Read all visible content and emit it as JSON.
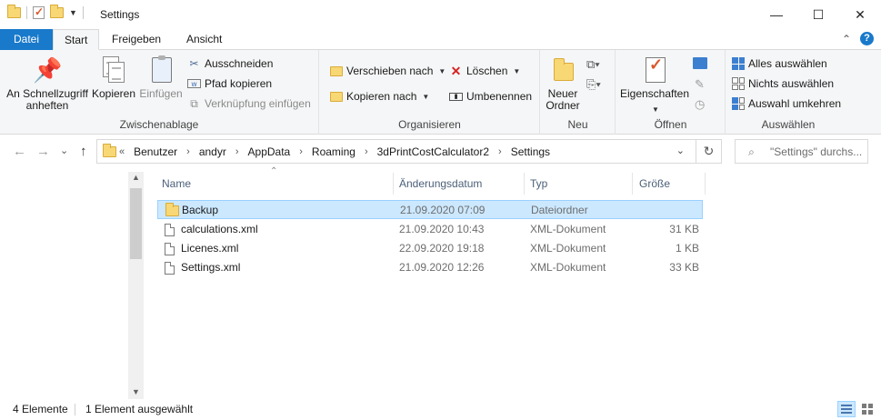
{
  "window": {
    "title": "Settings",
    "minimize_glyph": "—",
    "maximize_glyph": "☐",
    "close_glyph": "✕"
  },
  "tabs": {
    "file": "Datei",
    "start": "Start",
    "share": "Freigeben",
    "view": "Ansicht"
  },
  "ribbon": {
    "clipboard": {
      "label": "Zwischenablage",
      "pin_quick_access": "An Schnellzugriff anheften",
      "copy": "Kopieren",
      "paste": "Einfügen",
      "cut": "Ausschneiden",
      "copy_path": "Pfad kopieren",
      "paste_shortcut": "Verknüpfung einfügen"
    },
    "organize": {
      "label": "Organisieren",
      "move_to": "Verschieben nach",
      "copy_to": "Kopieren nach",
      "delete": "Löschen",
      "rename": "Umbenennen"
    },
    "new": {
      "label": "Neu",
      "new_folder": "Neuer Ordner"
    },
    "open": {
      "label": "Öffnen",
      "properties": "Eigenschaften"
    },
    "select": {
      "label": "Auswählen",
      "select_all": "Alles auswählen",
      "select_none": "Nichts auswählen",
      "invert_selection": "Auswahl umkehren"
    }
  },
  "navigation": {
    "back_glyph": "←",
    "forward_glyph": "→",
    "recent_glyph": "⌄",
    "up_glyph": "↑",
    "overflow_glyph": "«",
    "breadcrumb": [
      "Benutzer",
      "andyr",
      "AppData",
      "Roaming",
      "3dPrintCostCalculator2",
      "Settings"
    ],
    "crumb_separator": "›",
    "dropdown_glyph": "⌄",
    "refresh_glyph": "↻",
    "search_placeholder": "\"Settings\" durchs..."
  },
  "columns": {
    "name": "Name",
    "date": "Änderungsdatum",
    "type": "Typ",
    "size": "Größe"
  },
  "files": [
    {
      "name": "Backup",
      "date": "21.09.2020 07:09",
      "type": "Dateiordner",
      "size": "",
      "kind": "folder",
      "selected": true
    },
    {
      "name": "calculations.xml",
      "date": "21.09.2020 10:43",
      "type": "XML-Dokument",
      "size": "31 KB",
      "kind": "file",
      "selected": false
    },
    {
      "name": "Licenes.xml",
      "date": "22.09.2020 19:18",
      "type": "XML-Dokument",
      "size": "1 KB",
      "kind": "file",
      "selected": false
    },
    {
      "name": "Settings.xml",
      "date": "21.09.2020 12:26",
      "type": "XML-Dokument",
      "size": "33 KB",
      "kind": "file",
      "selected": false
    }
  ],
  "status": {
    "item_count": "4 Elemente",
    "selection": "1 Element ausgewählt"
  },
  "colors": {
    "accent": "#1979ca",
    "selection_bg": "#cce8ff",
    "selection_border": "#99d1ff",
    "folder": "#f8d775"
  }
}
